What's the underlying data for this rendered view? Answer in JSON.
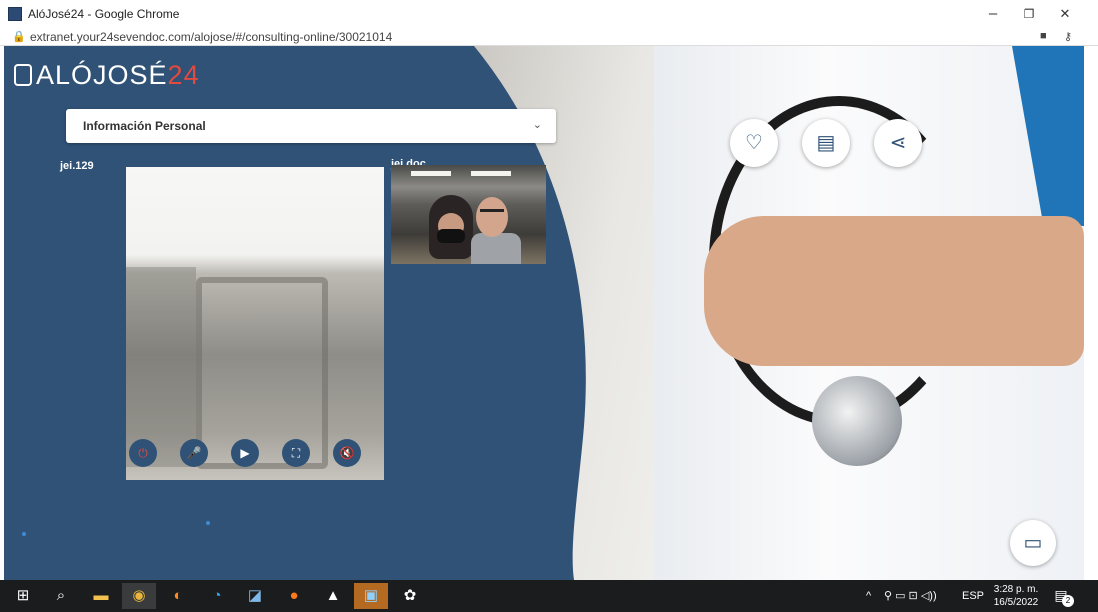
{
  "window": {
    "title": "AlóJosé24 - Google Chrome",
    "minimize_glyph": "–",
    "restore_glyph": "❐",
    "close_glyph": "✕"
  },
  "address_bar": {
    "lock_icon": "🔒",
    "url": "extranet.your24sevendoc.com/alojose/#/consulting-online/30021014",
    "camera_icon": "■",
    "key_icon": "⚷"
  },
  "app": {
    "logo_text": "ALÓJOSÉ",
    "logo_number": "24",
    "personal_info_label": "Información Personal",
    "chevron": "⌄",
    "local_user": "jei.129",
    "remote_user": "jei.doc",
    "controls": [
      {
        "name": "power-button",
        "glyph": "⏻",
        "color": "red"
      },
      {
        "name": "mute-mic-button",
        "glyph": "🎤",
        "color": "red"
      },
      {
        "name": "camera-button",
        "glyph": "▶",
        "color": "white"
      },
      {
        "name": "fullscreen-button",
        "glyph": "⛶",
        "color": "white"
      },
      {
        "name": "mute-speaker-button",
        "glyph": "🔇",
        "color": "red"
      }
    ],
    "fabs": {
      "health": "♡",
      "archive": "▤",
      "share": "⋖",
      "chat": "▭"
    },
    "colors": {
      "navy": "#2f5276",
      "logo_accent": "#e34a3f",
      "control_red": "#e34a3f"
    }
  },
  "taskbar": {
    "start": "⊞",
    "search": "⌕",
    "apps": [
      "file-explorer",
      "chrome",
      "firefox",
      "edge",
      "app-notes",
      "app-orange",
      "photos",
      "app-active",
      "settings"
    ],
    "app_glyphs": [
      "▬",
      "◉",
      "◐",
      "◔",
      "◪",
      "●",
      "▲",
      "▣",
      "✿"
    ],
    "tray_up": "^",
    "tray_icons": "⚲ ▭ ⊡ ◁))",
    "language": "ESP",
    "time": "3:28 p. m.",
    "date": "16/5/2022",
    "notifications_count": "2",
    "notifications_glyph": "▤"
  }
}
